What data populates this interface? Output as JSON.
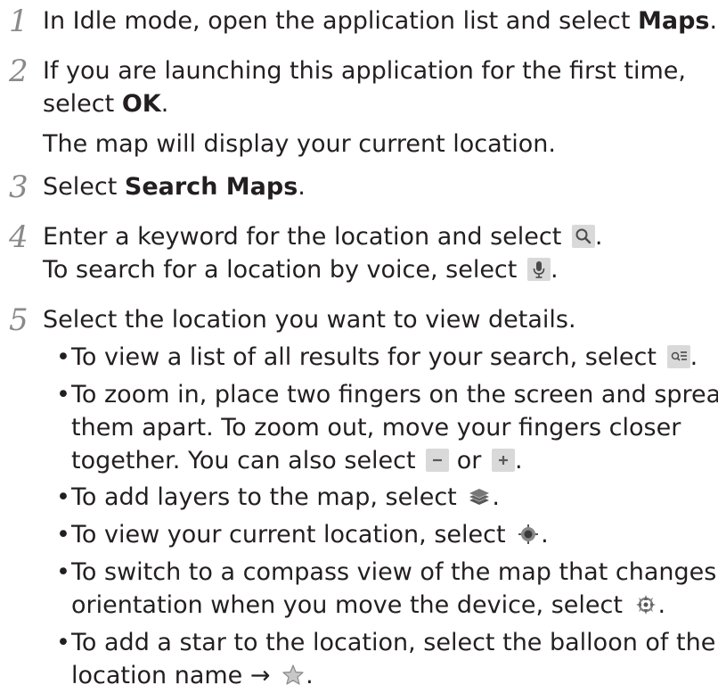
{
  "steps": [
    {
      "number": "1",
      "lines": [
        {
          "pre": "In Idle mode, open the application list and select ",
          "bold": "Maps",
          "post": "."
        }
      ]
    },
    {
      "number": "2",
      "lines": [
        {
          "text": "If you are launching this application for the first time,"
        },
        {
          "pre": "select ",
          "bold": "OK",
          "post": "."
        },
        {
          "text": "The map will display your current location."
        }
      ]
    },
    {
      "number": "3",
      "lines": [
        {
          "pre": "Select ",
          "bold": "Search Maps",
          "post": "."
        }
      ]
    },
    {
      "number": "4",
      "lines": [
        {
          "pre": "Enter a keyword for the location and select ",
          "post": "."
        },
        {
          "pre": "To search for a location by voice, select ",
          "post": "."
        }
      ]
    },
    {
      "number": "5",
      "lines": [
        {
          "text": "Select the location you want to view details."
        }
      ]
    }
  ],
  "bullets": [
    {
      "lines": [
        {
          "pre": "To view a list of all results for your search, select ",
          "post": "."
        }
      ]
    },
    {
      "lines": [
        {
          "text": "To zoom in, place two fingers on the screen and spread"
        },
        {
          "text": "them apart. To zoom out, move your fingers closer"
        },
        {
          "pre": "together. You can also select ",
          "mid": " or ",
          "post": "."
        }
      ]
    },
    {
      "lines": [
        {
          "pre": "To add layers to the map, select ",
          "post": "."
        }
      ]
    },
    {
      "lines": [
        {
          "pre": "To view your current location, select ",
          "post": "."
        }
      ]
    },
    {
      "lines": [
        {
          "text": "To switch to a compass view of the map that changes"
        },
        {
          "pre": "orientation when you move the device, select ",
          "post": "."
        }
      ]
    },
    {
      "lines": [
        {
          "text": "To add a star to the location, select the balloon of the"
        },
        {
          "pre": "location name → ",
          "post": "."
        }
      ]
    }
  ],
  "bullet_char": "•",
  "icons": {
    "search": "search-icon",
    "mic": "microphone-icon",
    "results_list": "results-list-icon",
    "zoom_out": "zoom-out-icon",
    "zoom_in": "zoom-in-icon",
    "layers": "layers-icon",
    "my_location": "my-location-icon",
    "compass": "compass-icon",
    "star": "star-icon"
  },
  "colors": {
    "text": "#231f20",
    "step_number": "#8a8a8a",
    "icon_bg": "#d9d9d9"
  }
}
